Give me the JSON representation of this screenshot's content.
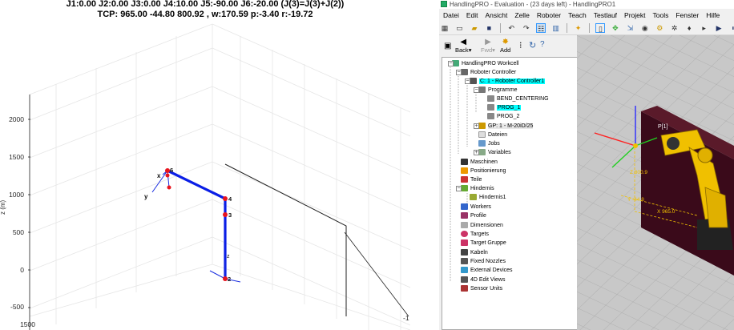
{
  "plot": {
    "title_line1": "J1:0.00 J2:0.00 J3:0.00 J4:10.00 J5:-90.00 J6:-20.00 (J(3)=J(3)+J(2))",
    "title_line2": "TCP: 965.00 -44.80 800.92 , w:170.59 p:-3.40 r:-19.72",
    "z_ticks": [
      "2000",
      "1500",
      "1000",
      "500",
      "0",
      "-500"
    ],
    "y_tick_bottom": "1500",
    "axis_label_z": "z (m)",
    "right_tick": "-1",
    "joint_labels": [
      "6",
      "4",
      "3",
      "2"
    ],
    "frame_labels": {
      "x": "x",
      "y": "y",
      "z": "z"
    },
    "colors": {
      "link": "#0a1ee6",
      "joint": "#e8141e"
    }
  },
  "app": {
    "window_title": "HandlingPRO - Evaluation - (23 days left) - HandlingPRO1",
    "menu": [
      "Datei",
      "Edit",
      "Ansicht",
      "Zelle",
      "Roboter",
      "Teach",
      "Testlauf",
      "Projekt",
      "Tools",
      "Fenster",
      "Hilfe"
    ],
    "nav": {
      "back": "Back",
      "fwd": "Fwd",
      "add": "Add"
    },
    "tree": [
      {
        "label": "HandlingPRO Workcell",
        "icon": "workcell-icon",
        "color": "#4a7"
      },
      {
        "label": "Roboter Controller",
        "icon": "controller-icon",
        "color": "#666"
      },
      {
        "label": "C: 1 - Roboter Controller1",
        "icon": "controller-icon",
        "color": "#555",
        "selected": true
      },
      {
        "label": "Programme",
        "icon": "folder-icon",
        "color": "#777"
      },
      {
        "label": "BEND_CENTERING",
        "icon": "program-icon",
        "color": "#888"
      },
      {
        "label": "PROG_1",
        "icon": "program-icon",
        "color": "#888",
        "selected": true
      },
      {
        "label": "PROG_2",
        "icon": "program-icon",
        "color": "#888"
      },
      {
        "label": "GP: 1 - M-20iD/25",
        "icon": "robot-icon",
        "color": "#c90"
      },
      {
        "label": "Dateien",
        "icon": "file-icon",
        "color": "#ddd"
      },
      {
        "label": "Jobs",
        "icon": "jobs-icon",
        "color": "#69c"
      },
      {
        "label": "Variables",
        "icon": "variables-icon",
        "color": "#8a8"
      },
      {
        "label": "Maschinen",
        "icon": "machine-icon",
        "color": "#333"
      },
      {
        "label": "Positionierung",
        "icon": "positioner-icon",
        "color": "#e90"
      },
      {
        "label": "Teile",
        "icon": "part-icon",
        "color": "#c33"
      },
      {
        "label": "Hindernis",
        "icon": "obstacle-icon",
        "color": "#6a3"
      },
      {
        "label": "Hindernis1",
        "icon": "obstacle-item-icon",
        "color": "#9a3"
      },
      {
        "label": "Workers",
        "icon": "worker-icon",
        "color": "#36c"
      },
      {
        "label": "Profile",
        "icon": "profile-icon",
        "color": "#936"
      },
      {
        "label": "Dimensionen",
        "icon": "dimension-icon",
        "color": "#aaa"
      },
      {
        "label": "Targets",
        "icon": "target-icon",
        "color": "#c36"
      },
      {
        "label": "Target Gruppe",
        "icon": "target-group-icon",
        "color": "#c36"
      },
      {
        "label": "Kabeln",
        "icon": "cable-icon",
        "color": "#444"
      },
      {
        "label": "Fixed Nozzles",
        "icon": "nozzle-icon",
        "color": "#555"
      },
      {
        "label": "External Devices",
        "icon": "device-icon",
        "color": "#39c"
      },
      {
        "label": "4D Edit Views",
        "icon": "view-icon",
        "color": "#555"
      },
      {
        "label": "Sensor Units",
        "icon": "sensor-icon",
        "color": "#a33"
      }
    ],
    "viewport_labels": [
      "P[1]",
      "Z 800.9",
      "Y -44.8",
      "X 965.0"
    ],
    "colors": {
      "selection": "#00ffff",
      "robot": "#f0c000",
      "fixture": "#3a0a1a",
      "floor": "#c8c8c8"
    }
  }
}
